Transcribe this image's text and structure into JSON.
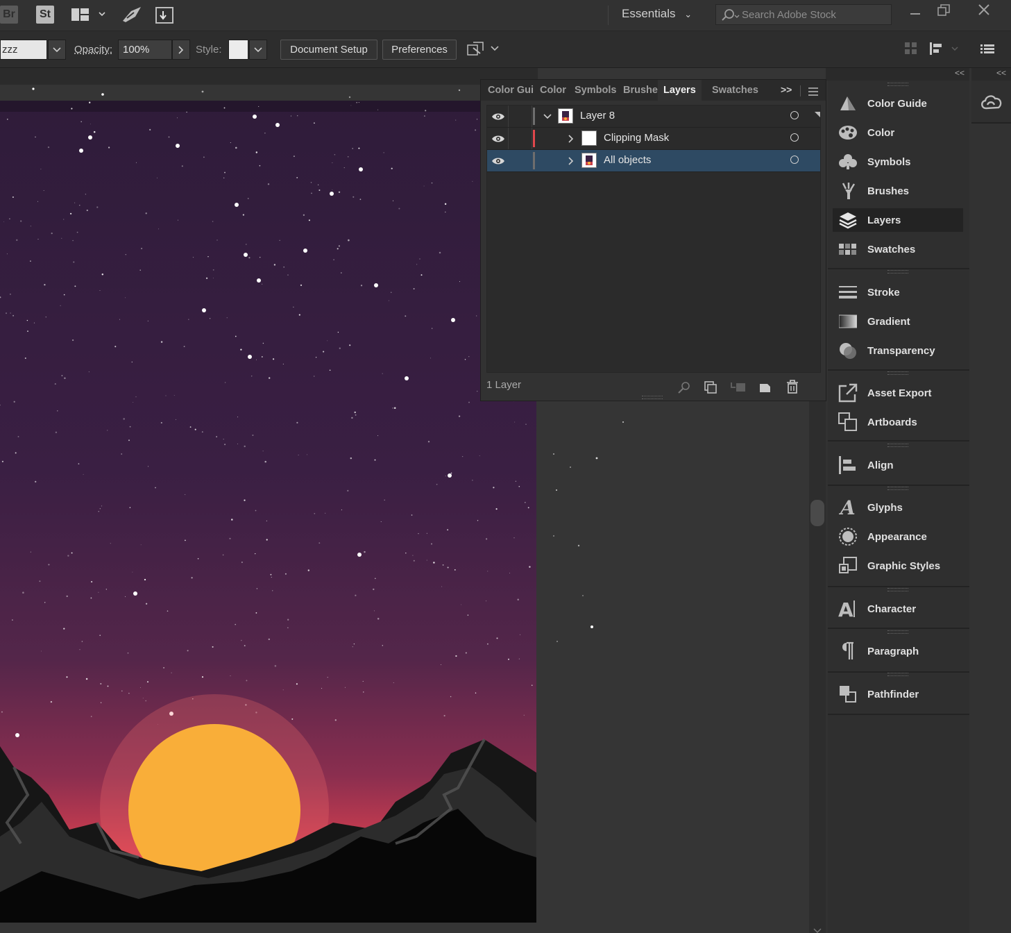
{
  "appbar": {
    "bridge_label": "Br",
    "stock_label": "St",
    "workspace_label": "Essentials",
    "search_placeholder": "Search Adobe Stock"
  },
  "control_bar": {
    "swatch_value": "zzz",
    "opacity_label": "Opacity:",
    "opacity_value": "100%",
    "style_label": "Style:",
    "document_setup_label": "Document Setup",
    "preferences_label": "Preferences"
  },
  "layers_panel": {
    "tabs": [
      "Color Gui",
      "Color",
      "Symbols",
      "Brushes",
      "Layers",
      "Swatches"
    ],
    "active_tab": "Layers",
    "overflow_label": ">>",
    "rows": [
      {
        "name": "Layer 8",
        "color": "#6e6e6e",
        "expanded": true,
        "selected": false
      },
      {
        "name": "Clipping Mask",
        "color": "#e0474c",
        "expanded": false,
        "selected": false
      },
      {
        "name": "All objects",
        "color": "#6e6e6e",
        "expanded": false,
        "selected": true
      }
    ],
    "footer_count": "1 Layer"
  },
  "dock": {
    "collapse_label": "<<",
    "items": [
      {
        "label": "Color Guide",
        "icon": "color-guide-icon",
        "active": false
      },
      {
        "label": "Color",
        "icon": "color-palette-icon",
        "active": false
      },
      {
        "label": "Symbols",
        "icon": "symbols-icon",
        "active": false
      },
      {
        "label": "Brushes",
        "icon": "brushes-icon",
        "active": false
      },
      {
        "label": "Layers",
        "icon": "layers-icon",
        "active": true
      },
      {
        "label": "Swatches",
        "icon": "swatches-icon",
        "active": false
      },
      {
        "label": "Stroke",
        "icon": "stroke-icon",
        "active": false
      },
      {
        "label": "Gradient",
        "icon": "gradient-icon",
        "active": false
      },
      {
        "label": "Transparency",
        "icon": "transparency-icon",
        "active": false
      },
      {
        "label": "Asset Export",
        "icon": "asset-export-icon",
        "active": false
      },
      {
        "label": "Artboards",
        "icon": "artboards-icon",
        "active": false
      },
      {
        "label": "Align",
        "icon": "align-icon",
        "active": false
      },
      {
        "label": "Glyphs",
        "icon": "glyphs-icon",
        "active": false
      },
      {
        "label": "Appearance",
        "icon": "appearance-icon",
        "active": false
      },
      {
        "label": "Graphic Styles",
        "icon": "graphic-styles-icon",
        "active": false
      },
      {
        "label": "Character",
        "icon": "character-icon",
        "active": false
      },
      {
        "label": "Paragraph",
        "icon": "paragraph-icon",
        "active": false
      },
      {
        "label": "Pathfinder",
        "icon": "pathfinder-icon",
        "active": false
      }
    ]
  },
  "colors": {
    "sky_top": "#2f1c3a",
    "sky_mid": "#5a2847",
    "horizon": "#d9404f",
    "sun": "#f9ae39",
    "selection": "#2e4a63"
  }
}
